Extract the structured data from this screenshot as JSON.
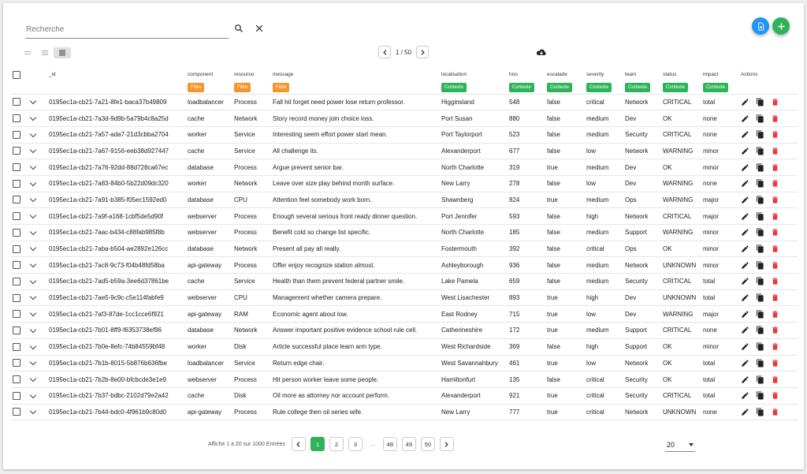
{
  "search": {
    "placeholder": "Recherche"
  },
  "pager_top": {
    "label": "1 / 50"
  },
  "columns": {
    "id": "_id",
    "component": "component",
    "resource": "resource",
    "message": "message",
    "localisation": "localisation",
    "hno": "hno",
    "escalade": "escalade",
    "severity": "severity",
    "team": "team",
    "status": "status",
    "impact": "impact",
    "actions": "Actions"
  },
  "filters": {
    "filtre": "Filtre",
    "contexte": "Contexte"
  },
  "rows": [
    {
      "id": "0195ec1a-cb21-7a21-8fe1-baca37b49809",
      "component": "loadbalancer",
      "resource": "Process",
      "message": "Fall hit forget need power lose return professor.",
      "localisation": "Higginsland",
      "hno": "548",
      "escalade": "false",
      "severity": "critical",
      "team": "Network",
      "status": "CRITICAL",
      "impact": "total"
    },
    {
      "id": "0195ec1a-cb21-7a3d-9d9b-5a79b4c8a25d",
      "component": "cache",
      "resource": "Network",
      "message": "Story record money join choice loss.",
      "localisation": "Port Susan",
      "hno": "880",
      "escalade": "false",
      "severity": "medium",
      "team": "Dev",
      "status": "OK",
      "impact": "none"
    },
    {
      "id": "0195ec1a-cb21-7a57-ada7-21d3cbba2704",
      "component": "worker",
      "resource": "Service",
      "message": "Interesting seem effort power start mean.",
      "localisation": "Port Taylorport",
      "hno": "523",
      "escalade": "false",
      "severity": "medium",
      "team": "Security",
      "status": "CRITICAL",
      "impact": "none"
    },
    {
      "id": "0195ec1a-cb21-7a67-9156-eeb38d927447",
      "component": "cache",
      "resource": "Service",
      "message": "All challenge its.",
      "localisation": "Alexanderport",
      "hno": "677",
      "escalade": "false",
      "severity": "low",
      "team": "Network",
      "status": "WARNING",
      "impact": "minor"
    },
    {
      "id": "0195ec1a-cb21-7a76-92dd-88d728ca67ec",
      "component": "database",
      "resource": "Process",
      "message": "Argue prevent senior bar.",
      "localisation": "North Charlotte",
      "hno": "319",
      "escalade": "true",
      "severity": "medium",
      "team": "Dev",
      "status": "OK",
      "impact": "minor"
    },
    {
      "id": "0195ec1a-cb21-7a83-84b0-5b22d09dc320",
      "component": "worker",
      "resource": "Network",
      "message": "Leave over size play behind month surface.",
      "localisation": "New Larry",
      "hno": "278",
      "escalade": "false",
      "severity": "low",
      "team": "Dev",
      "status": "WARNING",
      "impact": "none"
    },
    {
      "id": "0195ec1a-cb21-7a91-b385-f05ec1592ed0",
      "component": "database",
      "resource": "CPU",
      "message": "Attention feel somebody work born.",
      "localisation": "Shawnberg",
      "hno": "824",
      "escalade": "true",
      "severity": "medium",
      "team": "Ops",
      "status": "WARNING",
      "impact": "major"
    },
    {
      "id": "0195ec1a-cb21-7a9f-a168-1cbf5de5d90f",
      "component": "webserver",
      "resource": "Process",
      "message": "Enough several serious front ready dinner question.",
      "localisation": "Port Jennifer",
      "hno": "593",
      "escalade": "false",
      "severity": "high",
      "team": "Network",
      "status": "CRITICAL",
      "impact": "major"
    },
    {
      "id": "0195ec1a-cb21-7aac-b434-c88fab985f8b",
      "component": "webserver",
      "resource": "Process",
      "message": "Benefit cold so change list specific.",
      "localisation": "North Charlotte",
      "hno": "185",
      "escalade": "false",
      "severity": "medium",
      "team": "Support",
      "status": "WARNING",
      "impact": "minor"
    },
    {
      "id": "0195ec1a-cb21-7aba-b504-ae2892e126cc",
      "component": "database",
      "resource": "Network",
      "message": "Present all pay all really.",
      "localisation": "Fostermouth",
      "hno": "392",
      "escalade": "false",
      "severity": "critical",
      "team": "Ops",
      "status": "OK",
      "impact": "minor"
    },
    {
      "id": "0195ec1a-cb21-7ac8-9c73-f04b48fd58ba",
      "component": "api-gateway",
      "resource": "Process",
      "message": "Offer enjoy recognize station almost.",
      "localisation": "Ashleyborough",
      "hno": "936",
      "escalade": "false",
      "severity": "medium",
      "team": "Network",
      "status": "UNKNOWN",
      "impact": "minor"
    },
    {
      "id": "0195ec1a-cb21-7ad5-b59a-3ee6d37861be",
      "component": "cache",
      "resource": "Service",
      "message": "Health than them prevent federal partner smile.",
      "localisation": "Lake Pamela",
      "hno": "659",
      "escalade": "false",
      "severity": "medium",
      "team": "Security",
      "status": "CRITICAL",
      "impact": "total"
    },
    {
      "id": "0195ec1a-cb21-7ae5-9c9c-c5e114fabfe9",
      "component": "webserver",
      "resource": "CPU",
      "message": "Management whether camera prepare.",
      "localisation": "West Lisachester",
      "hno": "893",
      "escalade": "true",
      "severity": "high",
      "team": "Dev",
      "status": "UNKNOWN",
      "impact": "total"
    },
    {
      "id": "0195ec1a-cb21-7af3-87de-1cc1cce6f921",
      "component": "api-gateway",
      "resource": "RAM",
      "message": "Economic agent about low.",
      "localisation": "East Rodney",
      "hno": "715",
      "escalade": "true",
      "severity": "low",
      "team": "Dev",
      "status": "WARNING",
      "impact": "major"
    },
    {
      "id": "0195ec1a-cb21-7b01-8ff9-f6353738ef96",
      "component": "database",
      "resource": "Network",
      "message": "Answer important positive evidence school rule cell.",
      "localisation": "Catherineshire",
      "hno": "172",
      "escalade": "true",
      "severity": "medium",
      "team": "Support",
      "status": "CRITICAL",
      "impact": "none"
    },
    {
      "id": "0195ec1a-cb21-7b0e-8efc-74b84559bf48",
      "component": "worker",
      "resource": "Disk",
      "message": "Article successful place learn arm type.",
      "localisation": "West Richardside",
      "hno": "369",
      "escalade": "false",
      "severity": "high",
      "team": "Support",
      "status": "OK",
      "impact": "minor"
    },
    {
      "id": "0195ec1a-cb21-7b1b-8015-5b876b636fbe",
      "component": "loadbalancer",
      "resource": "Service",
      "message": "Return edge chair.",
      "localisation": "West Savannahbury",
      "hno": "461",
      "escalade": "true",
      "severity": "low",
      "team": "Network",
      "status": "OK",
      "impact": "total"
    },
    {
      "id": "0195ec1a-cb21-7b2b-8e00-bfcbcde3e1e9",
      "component": "webserver",
      "resource": "Process",
      "message": "Hit person worker leave some people.",
      "localisation": "Hamiltonfurt",
      "hno": "135",
      "escalade": "false",
      "severity": "critical",
      "team": "Security",
      "status": "OK",
      "impact": "total"
    },
    {
      "id": "0195ec1a-cb21-7b37-bdbc-2102d79e2a42",
      "component": "cache",
      "resource": "Disk",
      "message": "Oil more as attorney nor account perform.",
      "localisation": "Alexanderport",
      "hno": "921",
      "escalade": "true",
      "severity": "critical",
      "team": "Security",
      "status": "CRITICAL",
      "impact": "total"
    },
    {
      "id": "0195ec1a-cb21-7b44-bdc0-4f961b9c80d0",
      "component": "api-gateway",
      "resource": "Process",
      "message": "Rule college then oil series wife.",
      "localisation": "New Larry",
      "hno": "777",
      "escalade": "true",
      "severity": "critical",
      "team": "Network",
      "status": "UNKNOWN",
      "impact": "none"
    }
  ],
  "footer": {
    "summary": "Affiche 1 à 20 sur 1000 Entrées",
    "pages": [
      "1",
      "2",
      "3",
      "48",
      "49",
      "50"
    ],
    "ellipsis": "...",
    "page_size": "20"
  },
  "colors": {
    "accent_green": "#2fb35a",
    "accent_blue": "#2196f3",
    "filter_orange": "#f5962b",
    "delete_red": "#e53935"
  },
  "icons": [
    "search-icon",
    "close-icon",
    "file-add-icon",
    "plus-icon",
    "density-compact-icon",
    "density-standard-icon",
    "density-comfortable-icon",
    "chevron-left-icon",
    "chevron-right-icon",
    "cloud-download-icon",
    "expand-chevron-icon",
    "edit-icon",
    "copy-icon",
    "delete-icon",
    "dropdown-icon"
  ]
}
